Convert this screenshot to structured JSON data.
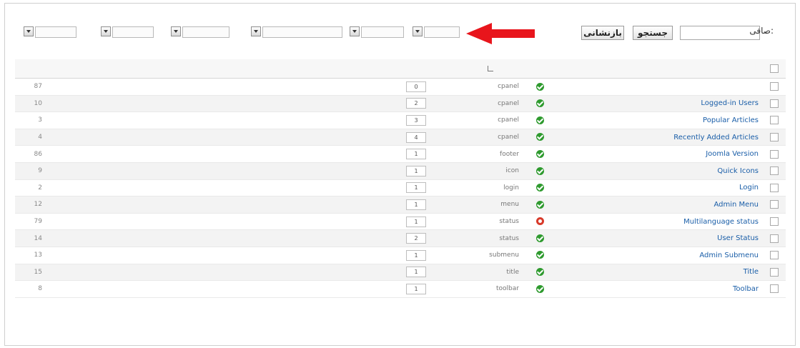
{
  "toolbar": {
    "search_label": "صافی:",
    "search_value": "",
    "search_button": "جستجو",
    "reset_button": "بازنشانی",
    "filters": [
      "",
      "",
      "",
      "",
      "",
      ""
    ]
  },
  "colors": {
    "link": "#1a5ea8",
    "header_text": "#1b4d84",
    "arrow": "#e8151c",
    "status_ok": "#2e9a2e",
    "status_bad": "#d83a2a"
  },
  "columns": {
    "checkbox": "",
    "title": "",
    "status": "",
    "position": "",
    "order": "",
    "type": "",
    "pages": "",
    "access": "",
    "language": "",
    "id": ""
  },
  "rows": [
    {
      "title": "",
      "status": "published",
      "position": "cpanel",
      "order": "0",
      "type": "",
      "pages": "",
      "access": "",
      "language": "",
      "id": "87"
    },
    {
      "title": "Logged-in Users",
      "status": "published",
      "position": "cpanel",
      "order": "2",
      "type": "",
      "pages": "",
      "access": "",
      "language": "",
      "id": "10"
    },
    {
      "title": "Popular Articles",
      "status": "published",
      "position": "cpanel",
      "order": "3",
      "type": "",
      "pages": "",
      "access": "",
      "language": "",
      "id": "3"
    },
    {
      "title": "Recently Added Articles",
      "status": "published",
      "position": "cpanel",
      "order": "4",
      "type": "",
      "pages": "",
      "access": "",
      "language": "",
      "id": "4"
    },
    {
      "title": "Joomla Version",
      "status": "published",
      "position": "footer",
      "order": "1",
      "type": "",
      "pages": "",
      "access": "",
      "language": "",
      "id": "86"
    },
    {
      "title": "Quick Icons",
      "status": "published",
      "position": "icon",
      "order": "1",
      "type": "",
      "pages": "",
      "access": "",
      "language": "",
      "id": "9"
    },
    {
      "title": "Login",
      "status": "published",
      "position": "login",
      "order": "1",
      "type": "",
      "pages": "",
      "access": "",
      "language": "",
      "id": "2"
    },
    {
      "title": "Admin Menu",
      "status": "published",
      "position": "menu",
      "order": "1",
      "type": "",
      "pages": "",
      "access": "",
      "language": "",
      "id": "12"
    },
    {
      "title": "Multilanguage status",
      "status": "unpublished",
      "position": "status",
      "order": "1",
      "type": "",
      "pages": "",
      "access": "",
      "language": "",
      "id": "79"
    },
    {
      "title": "User Status",
      "status": "published",
      "position": "status",
      "order": "2",
      "type": "",
      "pages": "",
      "access": "",
      "language": "",
      "id": "14"
    },
    {
      "title": "Admin Submenu",
      "status": "published",
      "position": "submenu",
      "order": "1",
      "type": "",
      "pages": "",
      "access": "",
      "language": "",
      "id": "13"
    },
    {
      "title": "Title",
      "status": "published",
      "position": "title",
      "order": "1",
      "type": "",
      "pages": "",
      "access": "",
      "language": "",
      "id": "15"
    },
    {
      "title": "Toolbar",
      "status": "published",
      "position": "toolbar",
      "order": "1",
      "type": "",
      "pages": "",
      "access": "",
      "language": "",
      "id": "8"
    }
  ]
}
